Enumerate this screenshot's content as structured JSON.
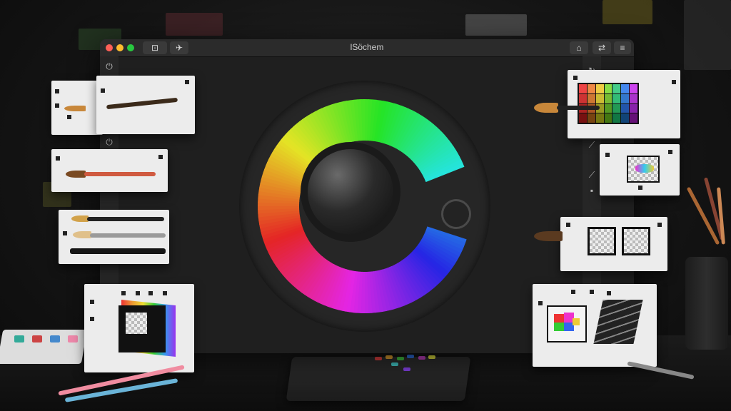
{
  "window": {
    "title": "lSöchem",
    "toolbar_left": [
      "⊡",
      "✈"
    ],
    "toolbar_right": [
      "⌂",
      "⇄",
      "≡"
    ]
  },
  "sidebar_left": [
    "⏻",
    "⏻"
  ],
  "sidebar_right": [
    "↻",
    "⟋",
    "⟋",
    "▪"
  ],
  "icons": {
    "close": "close-icon",
    "minimize": "minimize-icon",
    "maximize": "maximize-icon",
    "power": "power-icon",
    "brush": "brush-icon",
    "swatch": "swatch-icon"
  },
  "colors": {
    "close": "#ff5f57",
    "minimize": "#febc2e",
    "maximize": "#28c840",
    "wheel_gap": "#262626"
  }
}
